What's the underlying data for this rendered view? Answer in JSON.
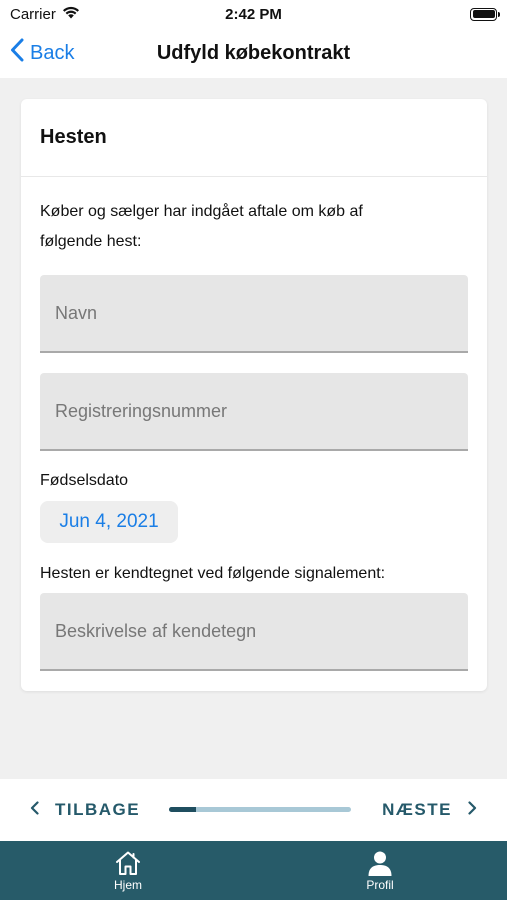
{
  "status_bar": {
    "carrier": "Carrier",
    "time": "2:42 PM"
  },
  "nav": {
    "back_label": "Back",
    "title": "Udfyld købekontrakt"
  },
  "card": {
    "title": "Hesten",
    "intro_line1": "Køber og sælger har indgået aftale om køb af",
    "intro_line2": "følgende hest:",
    "name_placeholder": "Navn",
    "registration_placeholder": "Registreringsnummer",
    "dob_label": "Fødselsdato",
    "dob_value": "Jun 4, 2021",
    "signalement_label": "Hesten er kendtegnet ved følgende signalement:",
    "description_placeholder": "Beskrivelse af kendetegn"
  },
  "footer": {
    "prev_label": "TILBAGE",
    "next_label": "NÆSTE",
    "progress_fraction": 0.15
  },
  "tabs": [
    {
      "label": "Hjem",
      "icon": "home-icon"
    },
    {
      "label": "Profil",
      "icon": "profile-icon"
    }
  ],
  "colors": {
    "accent": "#1a7ee6",
    "brand": "#275b69",
    "footer_text": "#25596a",
    "progress_track": "#a8c8d6",
    "progress_fill": "#1f4e5f"
  }
}
